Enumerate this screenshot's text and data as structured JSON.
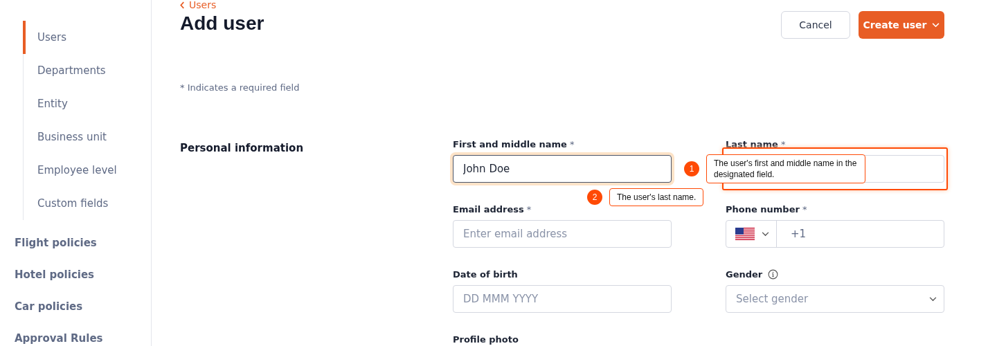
{
  "sidebar": {
    "sub_items": [
      {
        "label": "Users",
        "selected": true
      },
      {
        "label": "Departments",
        "selected": false
      },
      {
        "label": "Entity",
        "selected": false
      },
      {
        "label": "Business unit",
        "selected": false
      },
      {
        "label": "Employee level",
        "selected": false
      },
      {
        "label": "Custom fields",
        "selected": false
      }
    ],
    "items": [
      {
        "label": "Flight policies"
      },
      {
        "label": "Hotel policies"
      },
      {
        "label": "Car policies"
      },
      {
        "label": "Approval Rules"
      }
    ]
  },
  "breadcrumb": "Users",
  "title": "Add user",
  "buttons": [
    {
      "label": "Cancel",
      "kind": "secondary"
    },
    {
      "label": "Create user",
      "kind": "primary"
    }
  ],
  "required_note": "* Indicates a required field",
  "section": {
    "title": "Personal information",
    "fields": [
      {
        "label": "First and middle name",
        "required_mark": "*",
        "kind": "text",
        "value": "John Doe",
        "focused": true
      },
      {
        "label": "Last name",
        "required_mark": "*",
        "kind": "text",
        "highlighted": true
      },
      {
        "label": "Email address",
        "required_mark": "*",
        "kind": "text",
        "placeholder": "Enter email address"
      },
      {
        "label": "Phone number",
        "required_mark": "*",
        "kind": "phone",
        "value": "+1"
      },
      {
        "label": "Date of birth",
        "kind": "text",
        "placeholder": "DD MMM YYYY"
      },
      {
        "label": "Gender",
        "kind": "select",
        "info": true,
        "placeholder": "Select gender"
      },
      {
        "label": "Profile photo",
        "kind": "label_only"
      }
    ]
  },
  "annotations": [
    {
      "number": "1",
      "text": "The user's first and middle name in the designated field."
    },
    {
      "number": "2",
      "text": "The user's last name."
    }
  ]
}
